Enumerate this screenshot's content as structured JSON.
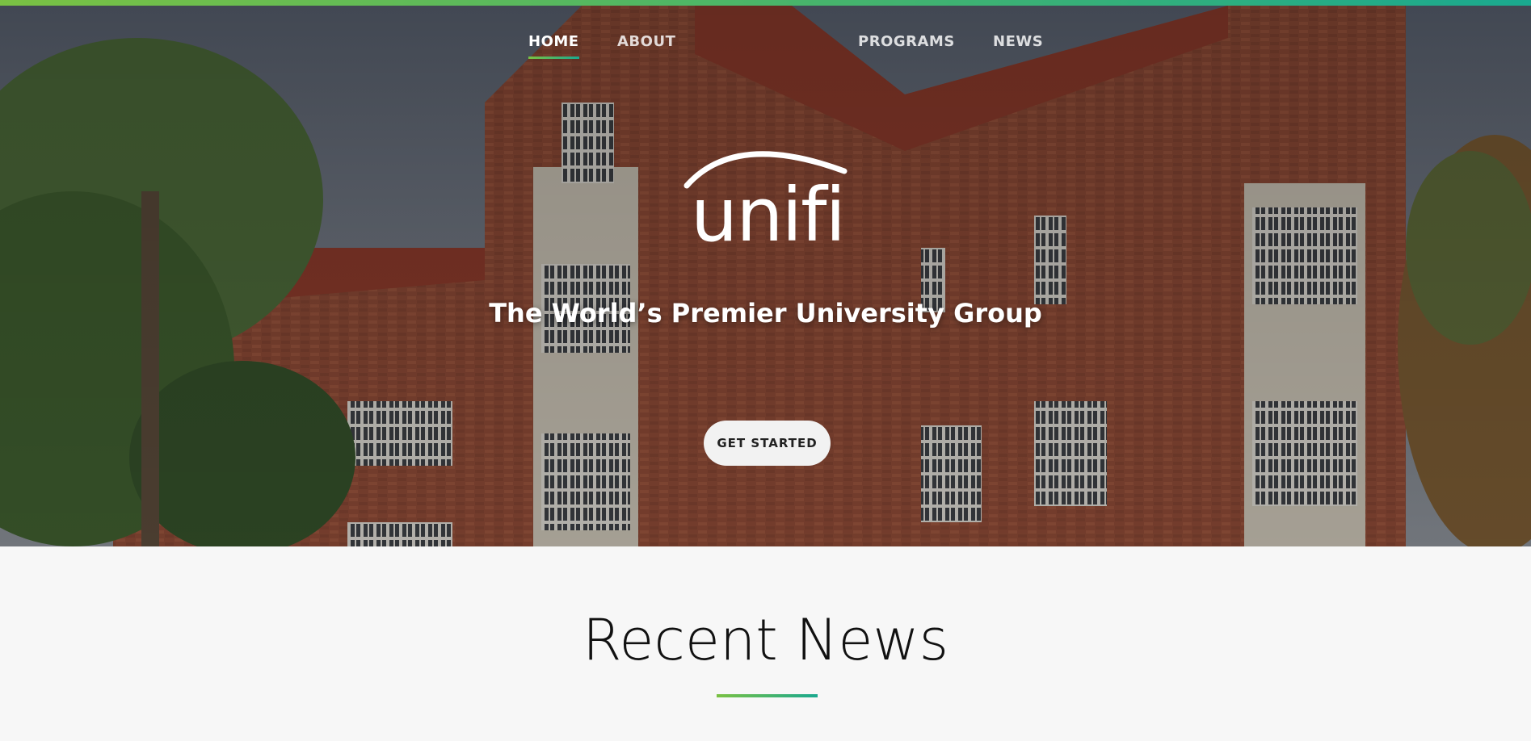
{
  "nav": {
    "items": [
      {
        "label": "HOME",
        "active": true
      },
      {
        "label": "ABOUT",
        "active": false
      },
      {
        "label": "PROGRAMS",
        "active": false
      },
      {
        "label": "NEWS",
        "active": false
      }
    ]
  },
  "hero": {
    "logo_text": "unifi",
    "tagline": "The World’s Premier University Group",
    "cta_label": "GET STARTED",
    "background_description_icon": "university-building-photo"
  },
  "news": {
    "heading": "Recent News"
  },
  "colors": {
    "accent_green": "#7ac143",
    "accent_teal": "#1aa98f",
    "text_dark": "#111111",
    "page_bg": "#f7f7f7"
  }
}
